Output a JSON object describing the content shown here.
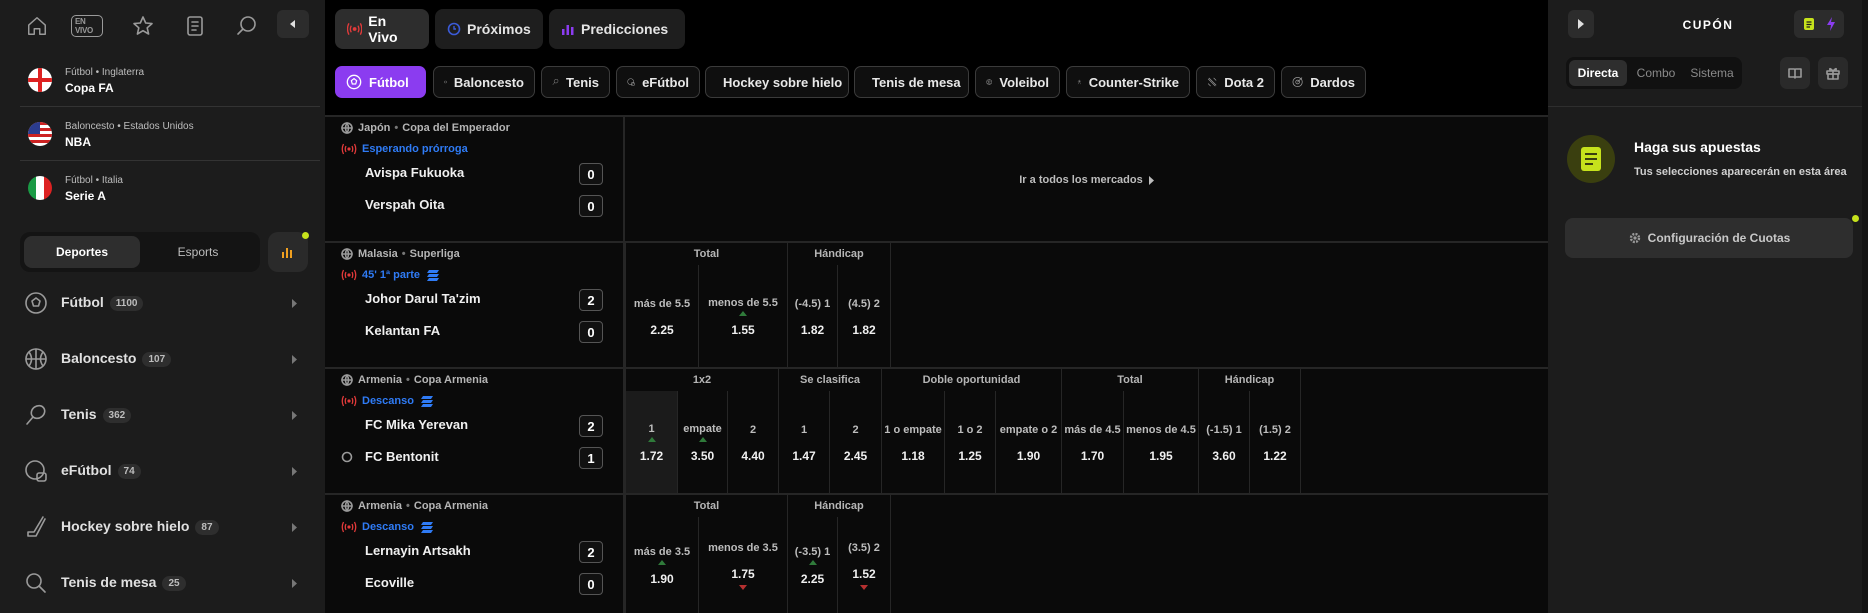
{
  "colors": {
    "accent": "#8b3cf0",
    "live": "#e23a3a",
    "status": "#2f7bf5",
    "highlight": "#c6e21c"
  },
  "sidebar": {
    "top_icons": [
      "home-icon",
      "en-vivo-icon",
      "star-icon",
      "betslip-history-icon",
      "search-icon",
      "collapse-icon"
    ],
    "en_vivo_badge": "EN VIVO",
    "favorites": [
      {
        "meta": "Fútbol • Inglaterra",
        "name": "Copa FA",
        "flag": "england"
      },
      {
        "meta": "Baloncesto • Estados Unidos",
        "name": "NBA",
        "flag": "usa"
      },
      {
        "meta": "Fútbol • Italia",
        "name": "Serie A",
        "flag": "italy"
      }
    ],
    "segment": {
      "deportes": "Deportes",
      "esports": "Esports",
      "selected": "Deportes"
    },
    "sports": [
      {
        "label": "Fútbol",
        "count": "1100",
        "icon": "soccer-ball-icon"
      },
      {
        "label": "Baloncesto",
        "count": "107",
        "icon": "basketball-icon"
      },
      {
        "label": "Tenis",
        "count": "362",
        "icon": "tennis-icon"
      },
      {
        "label": "eFútbol",
        "count": "74",
        "icon": "efootball-icon"
      },
      {
        "label": "Hockey sobre hielo",
        "count": "87",
        "icon": "hockey-icon"
      },
      {
        "label": "Tenis de mesa",
        "count": "25",
        "icon": "table-tennis-icon"
      }
    ]
  },
  "main": {
    "tabs": [
      {
        "label": "En Vivo"
      },
      {
        "label": "Próximos"
      },
      {
        "label": "Predicciones"
      }
    ],
    "selected_tab": "En Vivo",
    "chips": [
      {
        "label": "Fútbol"
      },
      {
        "label": "Baloncesto"
      },
      {
        "label": "Tenis"
      },
      {
        "label": "eFútbol"
      },
      {
        "label": "Hockey sobre hielo"
      },
      {
        "label": "Tenis de mesa"
      },
      {
        "label": "Voleibol"
      },
      {
        "label": "Counter-Strike"
      },
      {
        "label": "Dota 2"
      },
      {
        "label": "Dardos"
      }
    ],
    "selected_chip": "Fútbol",
    "events": [
      {
        "country": "Japón",
        "league": "Copa del Emperador",
        "status": "Esperando prórroga",
        "home": "Avispa Fukuoka",
        "away": "Verspah Oita",
        "home_score": "0",
        "away_score": "0",
        "all_markets": "Ir a todos los mercados"
      },
      {
        "country": "Malasia",
        "league": "Superliga",
        "status": "45' 1ª parte",
        "home": "Johor Darul Ta'zim",
        "away": "Kelantan FA",
        "home_score": "2",
        "away_score": "0",
        "groups": [
          {
            "title": "Total"
          },
          {
            "title": "Hándicap"
          }
        ],
        "odds": [
          {
            "label": "más de 5.5",
            "value": "2.25"
          },
          {
            "label": "menos de 5.5",
            "value": "1.55",
            "trend": "up"
          },
          {
            "label": "(-4.5) 1",
            "value": "1.82"
          },
          {
            "label": "(4.5) 2",
            "value": "1.82"
          }
        ]
      },
      {
        "country": "Armenia",
        "league": "Copa Armenia",
        "status": "Descanso",
        "home": "FC Mika Yerevan",
        "away": "FC Bentonit",
        "home_score": "2",
        "away_score": "1",
        "groups": [
          {
            "title": "1x2"
          },
          {
            "title": "Se clasifica"
          },
          {
            "title": "Doble oportunidad"
          },
          {
            "title": "Total"
          },
          {
            "title": "Hándicap"
          }
        ],
        "odds": [
          {
            "label": "1",
            "value": "1.72",
            "trend": "up"
          },
          {
            "label": "empate",
            "value": "3.50",
            "trend": "up"
          },
          {
            "label": "2",
            "value": "4.40"
          },
          {
            "label": "1",
            "value": "1.47"
          },
          {
            "label": "2",
            "value": "2.45"
          },
          {
            "label": "1 o empate",
            "value": "1.18"
          },
          {
            "label": "1 o 2",
            "value": "1.25"
          },
          {
            "label": "empate o 2",
            "value": "1.90"
          },
          {
            "label": "más de 4.5",
            "value": "1.70"
          },
          {
            "label": "menos de 4.5",
            "value": "1.95"
          },
          {
            "label": "(-1.5) 1",
            "value": "3.60"
          },
          {
            "label": "(1.5) 2",
            "value": "1.22"
          }
        ]
      },
      {
        "country": "Armenia",
        "league": "Copa Armenia",
        "status": "Descanso",
        "home": "Lernayin Artsakh",
        "away": "Ecoville",
        "home_score": "2",
        "away_score": "0",
        "groups": [
          {
            "title": "Total"
          },
          {
            "title": "Hándicap"
          }
        ],
        "odds": [
          {
            "label": "más de 3.5",
            "value": "1.90",
            "trend": "up"
          },
          {
            "label": "menos de 3.5",
            "value": "1.75",
            "trend": "down"
          },
          {
            "label": "(-3.5) 1",
            "value": "2.25",
            "trend": "up"
          },
          {
            "label": "(3.5) 2",
            "value": "1.52",
            "trend": "down"
          }
        ]
      }
    ]
  },
  "betslip": {
    "title": "CUPÓN",
    "modes": [
      {
        "label": "Directa"
      },
      {
        "label": "Combo"
      },
      {
        "label": "Sistema"
      }
    ],
    "selected_mode": "Directa",
    "empty_title": "Haga sus apuestas",
    "empty_sub": "Tus selecciones aparecerán en esta área",
    "odds_settings": "Configuración de Cuotas"
  }
}
